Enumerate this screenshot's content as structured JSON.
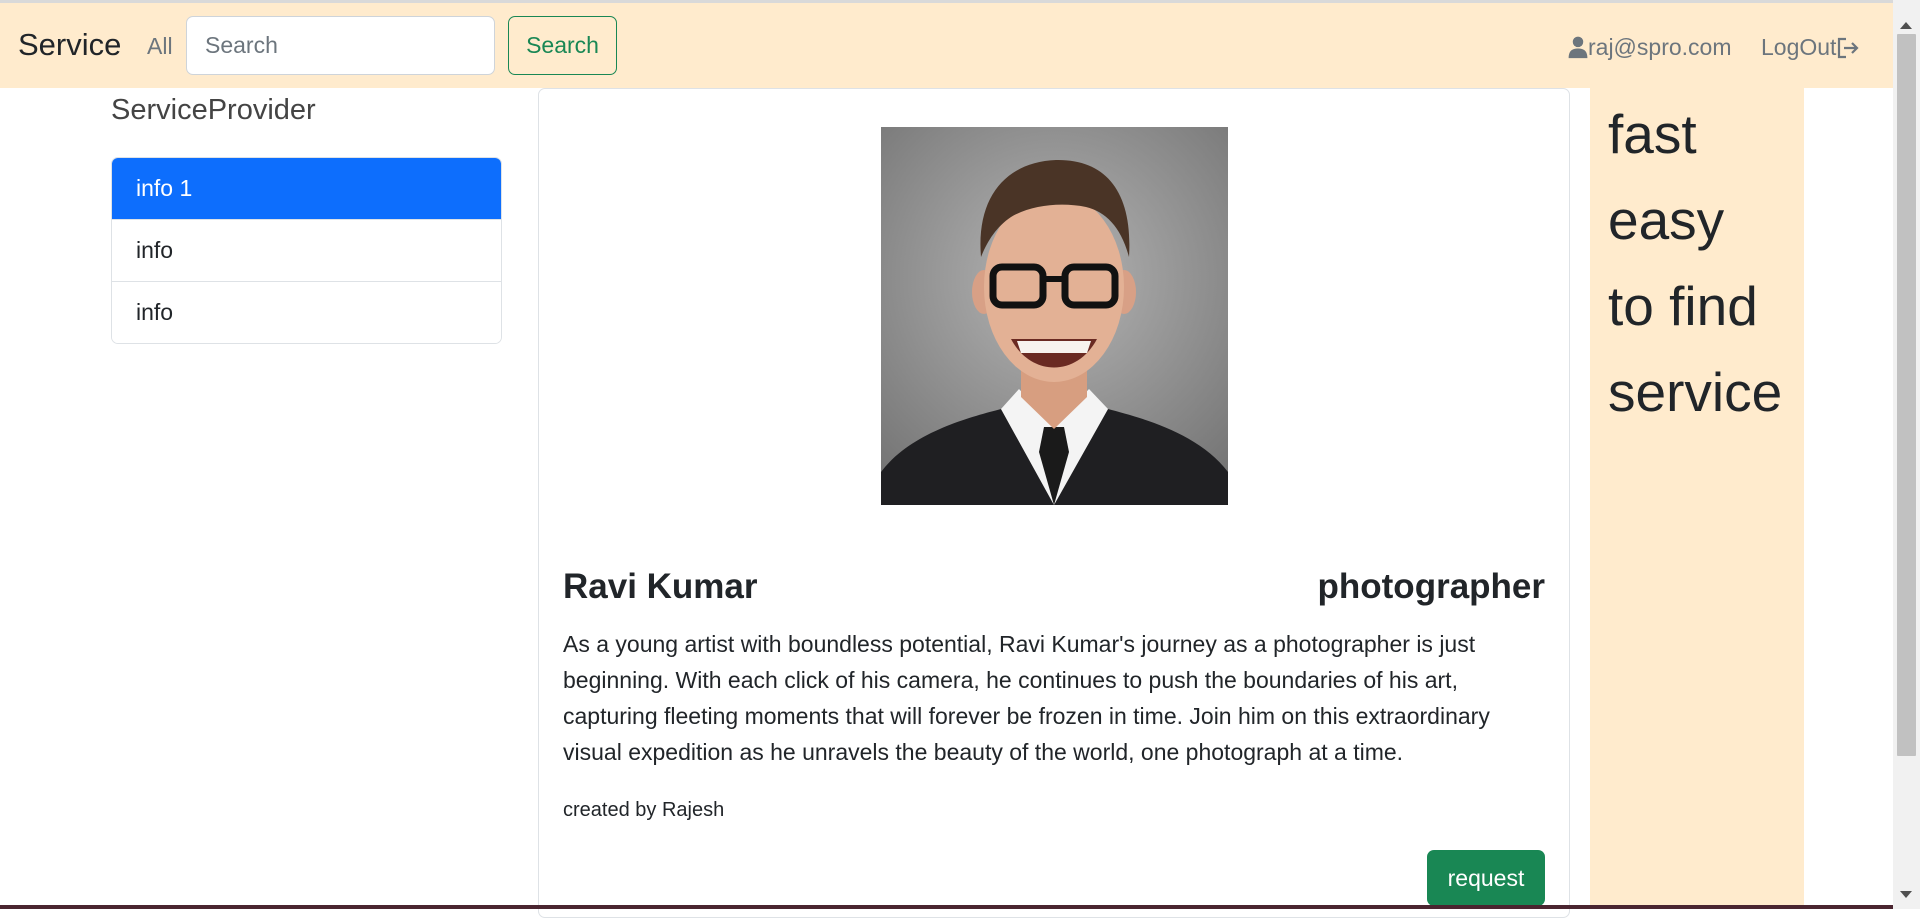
{
  "navbar": {
    "brand": "Service",
    "all_label": "All",
    "search_placeholder": "Search",
    "search_button": "Search",
    "user_email": "raj@spro.com",
    "logout_label": "LogOut"
  },
  "sidebar": {
    "title": "ServiceProvider",
    "items": [
      {
        "label": "info 1",
        "active": true
      },
      {
        "label": "info",
        "active": false
      },
      {
        "label": "info",
        "active": false
      }
    ]
  },
  "profile": {
    "name": "Ravi Kumar",
    "role": "photographer",
    "description": "As a young artist with boundless potential, Ravi Kumar's journey as a photographer is just beginning. With each click of his camera, he continues to push the boundaries of his art, capturing fleeting moments that will forever be frozen in time. Join him on this extraordinary visual expedition as he unravels the beauty of the world, one photograph at a time.",
    "created_by": "created by Rajesh",
    "request_button": "request"
  },
  "tagline": [
    "fast",
    "easy",
    "to find",
    "service"
  ],
  "colors": {
    "navbar_bg": "#ffebcd",
    "primary": "#0d6efd",
    "success": "#198754"
  },
  "icons": {
    "user": "person-icon",
    "logout": "box-arrow-right-icon"
  }
}
